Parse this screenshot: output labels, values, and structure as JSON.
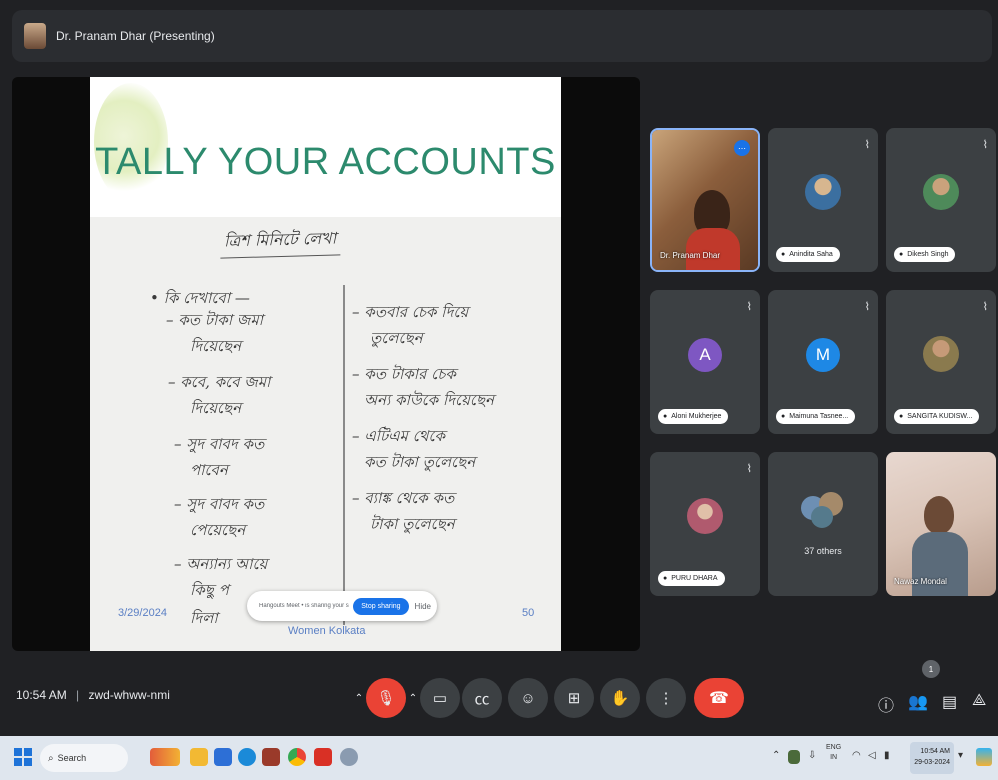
{
  "presenter_bar": {
    "title": "Dr. Pranam Dhar (Presenting)"
  },
  "slide": {
    "title": "TALLY YOUR ACCOUNTS",
    "handwritten_heading": "ত্রিশ মিনিটে লেখা",
    "left_column": [
      "• কি দেখাবো —",
      "– কত টাকা জমা",
      "দিয়েছেন",
      "– কবে, কবে জমা",
      "দিয়েছেন",
      "– সুদ বাবদ কত",
      "পাবেন",
      "– সুদ বাবদ কত",
      "পেয়েছেন",
      "– অন্যান্য আয়ে",
      "কিছু প",
      "দিলা"
    ],
    "right_column": [
      "– কতবার চেক দিয়ে",
      "তুলেছেন",
      "– কত টাকার চেক",
      "অন্য কাউকে দিয়েছেন",
      "– এটিএম থেকে",
      "কত টাকা তুলেছেন",
      "– ব্যাঙ্ক থেকে কত",
      "টাকা তুলেছেন"
    ],
    "date": "3/29/2024",
    "footer": "Women Kolkata",
    "page_number": "50"
  },
  "popup": {
    "text": "Hangouts Meet • is sharing your screen.",
    "stop_label": "Stop sharing",
    "hide_label": "Hide"
  },
  "participants": [
    {
      "name": "Dr. Pranam Dhar",
      "type": "video",
      "speaking": true
    },
    {
      "name": "Anindita Saha",
      "type": "photo",
      "color": "#3b6fa0"
    },
    {
      "name": "Dikesh Singh",
      "type": "photo",
      "color": "#4e8a5a"
    },
    {
      "name": "Aloni Mukherjee",
      "type": "initial",
      "initial": "A",
      "color": "#7e57c2"
    },
    {
      "name": "Maimuna Tasnee...",
      "type": "initial",
      "initial": "M",
      "color": "#1e88e5"
    },
    {
      "name": "SANGITA KUDISW...",
      "type": "photo",
      "color": "#8a7a4e"
    },
    {
      "name": "PURU DHARA",
      "type": "photo",
      "color": "#b05a6e"
    },
    {
      "name": "37 others",
      "type": "others"
    },
    {
      "name": "Nawaz Mondal",
      "type": "video"
    }
  ],
  "controls": {
    "clock": "10:54 AM",
    "separator": "|",
    "meeting_code": "zwd-whww-nmi",
    "hand_icon": "raise-hand-icon",
    "end_call_icon": "end-call-icon"
  },
  "taskbar": {
    "search_placeholder": "Search",
    "lang_top": "ENG",
    "lang_bottom": "IN",
    "time": "10:54 AM",
    "date": "29-03-2024"
  },
  "notification_count": "1",
  "colors": {
    "slide_title": "#2c8a6d",
    "accent": "#1a73e8",
    "end_call": "#ea4335",
    "background": "#202124"
  }
}
